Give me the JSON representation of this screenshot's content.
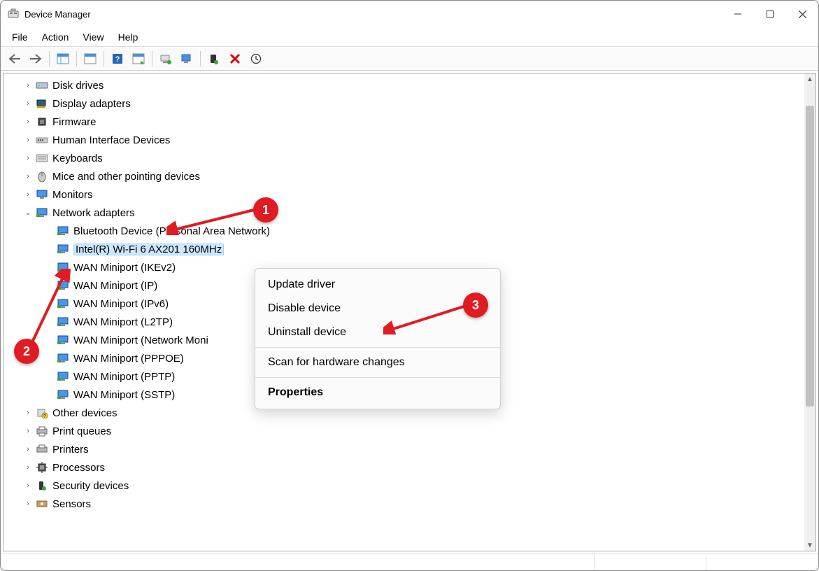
{
  "window": {
    "title": "Device Manager"
  },
  "menubar": [
    "File",
    "Action",
    "View",
    "Help"
  ],
  "tree": {
    "categories": [
      {
        "label": "Disk drives",
        "icon": "disk",
        "expanded": false
      },
      {
        "label": "Display adapters",
        "icon": "display",
        "expanded": false
      },
      {
        "label": "Firmware",
        "icon": "firmware",
        "expanded": false
      },
      {
        "label": "Human Interface Devices",
        "icon": "hid",
        "expanded": false
      },
      {
        "label": "Keyboards",
        "icon": "keyboard",
        "expanded": false
      },
      {
        "label": "Mice and other pointing devices",
        "icon": "mouse",
        "expanded": false
      },
      {
        "label": "Monitors",
        "icon": "monitor",
        "expanded": false
      },
      {
        "label": "Network adapters",
        "icon": "network",
        "expanded": true,
        "children": [
          {
            "label": "Bluetooth Device (Personal Area Network)",
            "selected": false
          },
          {
            "label": "Intel(R) Wi-Fi 6 AX201 160MHz",
            "selected": true
          },
          {
            "label": "WAN Miniport (IKEv2)",
            "selected": false
          },
          {
            "label": "WAN Miniport (IP)",
            "selected": false
          },
          {
            "label": "WAN Miniport (IPv6)",
            "selected": false
          },
          {
            "label": "WAN Miniport (L2TP)",
            "selected": false
          },
          {
            "label": "WAN Miniport (Network Moni",
            "selected": false
          },
          {
            "label": "WAN Miniport (PPPOE)",
            "selected": false
          },
          {
            "label": "WAN Miniport (PPTP)",
            "selected": false
          },
          {
            "label": "WAN Miniport (SSTP)",
            "selected": false
          }
        ]
      },
      {
        "label": "Other devices",
        "icon": "other",
        "expanded": false
      },
      {
        "label": "Print queues",
        "icon": "printqueue",
        "expanded": false
      },
      {
        "label": "Printers",
        "icon": "printer",
        "expanded": false
      },
      {
        "label": "Processors",
        "icon": "cpu",
        "expanded": false
      },
      {
        "label": "Security devices",
        "icon": "security",
        "expanded": false
      },
      {
        "label": "Sensors",
        "icon": "sensor",
        "expanded": false
      }
    ]
  },
  "context_menu": {
    "items": [
      {
        "label": "Update driver",
        "bold": false
      },
      {
        "label": "Disable device",
        "bold": false
      },
      {
        "label": "Uninstall device",
        "bold": false
      },
      {
        "sep": true
      },
      {
        "label": "Scan for hardware changes",
        "bold": false
      },
      {
        "sep": true
      },
      {
        "label": "Properties",
        "bold": true
      }
    ]
  },
  "annotations": {
    "b1": "1",
    "b2": "2",
    "b3": "3"
  }
}
